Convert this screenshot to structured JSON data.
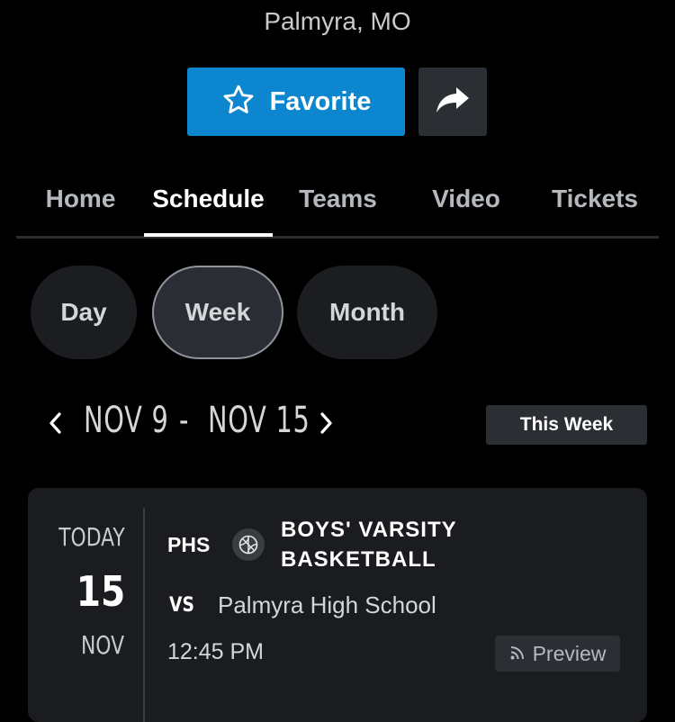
{
  "header": {
    "location": "Palmyra, MO",
    "favorite_label": "Favorite",
    "favorite_icon": "star-outline-icon",
    "share_icon": "share-arrow-icon"
  },
  "nav": {
    "tabs": [
      {
        "label": "Home"
      },
      {
        "label": "Schedule",
        "active": true
      },
      {
        "label": "Teams"
      },
      {
        "label": "Video"
      },
      {
        "label": "Tickets"
      }
    ]
  },
  "view_toggle": {
    "options": [
      {
        "label": "Day"
      },
      {
        "label": "Week",
        "active": true
      },
      {
        "label": "Month"
      }
    ]
  },
  "week": {
    "range_start": "NOV 9",
    "separator": "-",
    "range_end": "NOV 15",
    "this_week_label": "This Week"
  },
  "event": {
    "date_label": "TODAY",
    "day": "15",
    "month": "NOV",
    "team": "PHS",
    "sport_icon": "basketball-icon",
    "title_line1": "BOYS' VARSITY",
    "title_line2": "BASKETBALL",
    "vs_label": "VS",
    "opponent": "Palmyra High School",
    "time": "12:45 PM",
    "preview_label": "Preview",
    "preview_icon": "rss-icon"
  },
  "colors": {
    "background": "#000000",
    "accent": "#0b86cf",
    "card": "#1a1c1f",
    "button_dark": "#2b2e33"
  }
}
